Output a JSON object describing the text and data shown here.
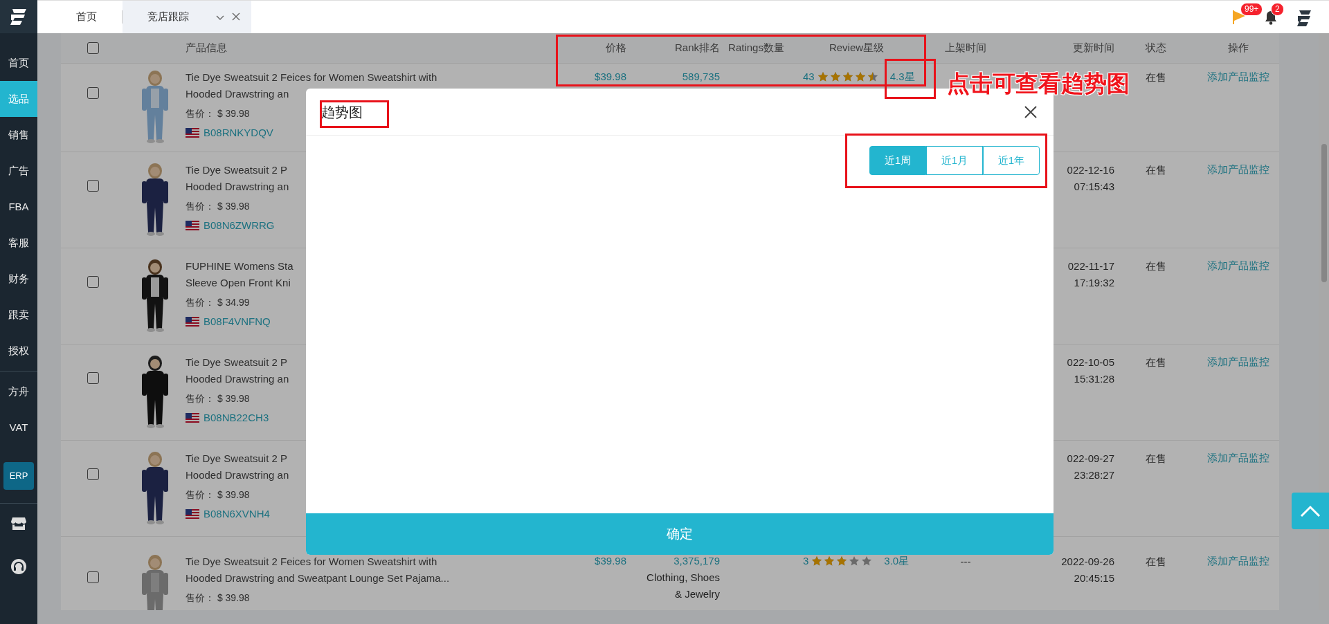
{
  "sidebar": {
    "items": [
      {
        "label": "首页",
        "selected": false
      },
      {
        "label": "选品",
        "selected": true
      },
      {
        "label": "销售",
        "selected": false
      },
      {
        "label": "广告",
        "selected": false
      },
      {
        "label": "FBA",
        "selected": false
      },
      {
        "label": "客服",
        "selected": false
      },
      {
        "label": "财务",
        "selected": false
      },
      {
        "label": "跟卖",
        "selected": false
      },
      {
        "label": "授权",
        "selected": false
      }
    ],
    "extra_items": [
      {
        "label": "方舟"
      },
      {
        "label": "VAT"
      }
    ],
    "erp_button": "ERP"
  },
  "tabs": [
    {
      "label": "首页",
      "selected": false,
      "closable": false
    },
    {
      "label": "竞店跟踪",
      "selected": true,
      "closable": true
    }
  ],
  "header": {
    "flag_badge": "99+",
    "bell_badge": "2"
  },
  "table": {
    "select_all": {
      "checked": false
    },
    "columns": [
      "产品信息",
      "价格",
      "Rank排名",
      "Ratings数量",
      "Review星级",
      "上架时间",
      "更新时间",
      "状态",
      "操作"
    ],
    "rows": [
      {
        "checked": false,
        "image": {
          "kind": "picture"
        },
        "title_lines": [
          "Tie Dye Sweatsuit 2 Feices for Women Sweatshirt with",
          "Hooded Drawstring an"
        ],
        "sale_price": "售价： $ 39.98",
        "asin": "B08RNKYDQV",
        "price": "$39.98",
        "rank": "589,735",
        "review_count": "43",
        "stars": 4.5,
        "review": "4.3星",
        "status": "在售",
        "action": "添加产品监控"
      },
      {
        "checked": false,
        "image": {
          "kind": "picture"
        },
        "title_lines": [
          "Tie Dye Sweatsuit 2 P",
          "Hooded Drawstring an"
        ],
        "sale_price": "售价： $ 39.98",
        "asin": "B08N6ZWRRG",
        "updated": [
          "022-12-16",
          "07:15:43"
        ],
        "status": "在售",
        "action": "添加产品监控"
      },
      {
        "checked": false,
        "image": {
          "kind": "picture"
        },
        "title_lines": [
          "FUPHINE Womens Sta",
          "Sleeve Open Front Kni"
        ],
        "sale_price": "售价： $ 34.99",
        "asin": "B08F4VNFNQ",
        "updated": [
          "022-11-17",
          "17:19:32"
        ],
        "status": "在售",
        "action": "添加产品监控"
      },
      {
        "checked": false,
        "image": {
          "kind": "picture"
        },
        "title_lines": [
          "Tie Dye Sweatsuit 2 P",
          "Hooded Drawstring an"
        ],
        "sale_price": "售价： $ 39.98",
        "asin": "B08NB22CH3",
        "updated": [
          "022-10-05",
          "15:31:28"
        ],
        "status": "在售",
        "action": "添加产品监控"
      },
      {
        "checked": false,
        "image": {
          "kind": "picture"
        },
        "title_lines": [
          "Tie Dye Sweatsuit 2 P",
          "Hooded Drawstring an"
        ],
        "sale_price": "售价： $ 39.98",
        "asin": "B08N6XVNH4",
        "updated": [
          "022-09-27",
          "23:28:27"
        ],
        "status": "在售",
        "action": "添加产品监控"
      },
      {
        "checked": false,
        "image": {
          "kind": "picture"
        },
        "title_lines": [
          "Tie Dye Sweatsuit 2 Feices for Women Sweatshirt with",
          "Hooded Drawstring and Sweatpant Lounge Set Pajama..."
        ],
        "sale_price": "售价： $ 39.98",
        "price": "$39.98",
        "rank": "3,375,179",
        "category": "Clothing, Shoes & Jewelry",
        "review_count": "3",
        "stars": 3,
        "review": "3.0星",
        "listed": "---",
        "updated": [
          "2022-09-26",
          "20:45:15"
        ],
        "status": "在售",
        "action": "添加产品监控"
      }
    ]
  },
  "modal": {
    "title": "趋势图",
    "ranges": [
      {
        "label": "近1周",
        "selected": true
      },
      {
        "label": "近1月",
        "selected": false
      },
      {
        "label": "近1年",
        "selected": false
      }
    ],
    "confirm": "确定"
  },
  "annotations": [
    {
      "kind": "frame"
    },
    {
      "kind": "frame"
    },
    {
      "kind": "frame"
    },
    {
      "kind": "frame"
    },
    {
      "kind": "callout",
      "text": "点击可查看趋势图"
    }
  ]
}
